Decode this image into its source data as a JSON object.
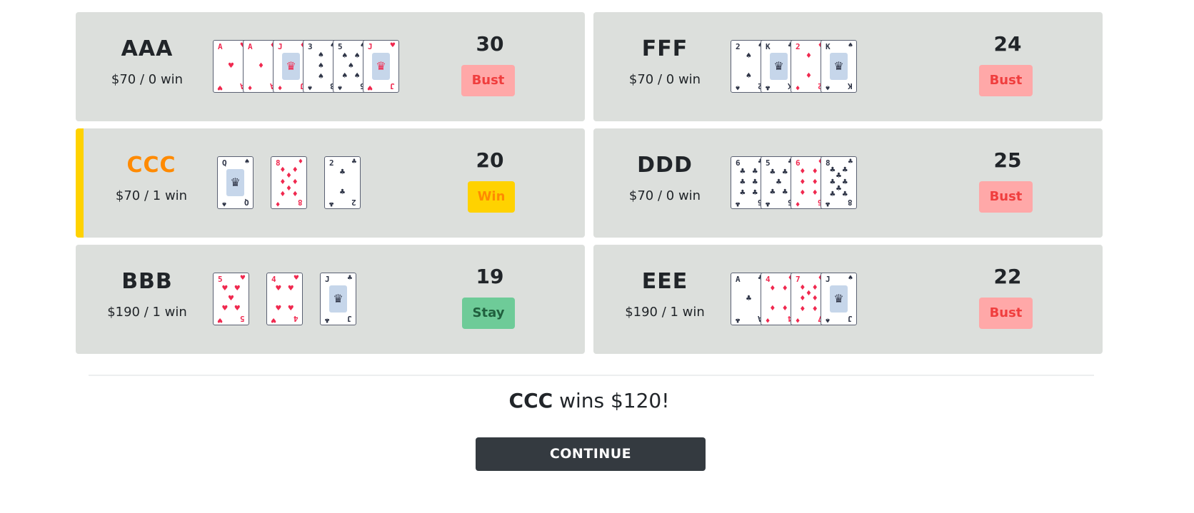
{
  "players": [
    {
      "name": "AAA",
      "money": "$70 / 0 win",
      "score": "30",
      "status": "Bust",
      "status_type": "bust",
      "active": false,
      "cards": [
        {
          "rank": "A",
          "suit": "♥",
          "color": "red"
        },
        {
          "rank": "A",
          "suit": "♦",
          "color": "red"
        },
        {
          "rank": "J",
          "suit": "♦",
          "color": "red"
        },
        {
          "rank": "3",
          "suit": "♠",
          "color": "black"
        },
        {
          "rank": "5",
          "suit": "♠",
          "color": "black"
        },
        {
          "rank": "J",
          "suit": "♥",
          "color": "red"
        }
      ]
    },
    {
      "name": "FFF",
      "money": "$70 / 0 win",
      "score": "24",
      "status": "Bust",
      "status_type": "bust",
      "active": false,
      "cards": [
        {
          "rank": "2",
          "suit": "♠",
          "color": "black"
        },
        {
          "rank": "K",
          "suit": "♣",
          "color": "black"
        },
        {
          "rank": "2",
          "suit": "♦",
          "color": "red"
        },
        {
          "rank": "K",
          "suit": "♠",
          "color": "black"
        }
      ]
    },
    {
      "name": "CCC",
      "money": "$70 / 1 win",
      "score": "20",
      "status": "Win",
      "status_type": "win",
      "active": true,
      "cards": [
        {
          "rank": "Q",
          "suit": "♠",
          "color": "black"
        },
        {
          "rank": "8",
          "suit": "♦",
          "color": "red"
        },
        {
          "rank": "2",
          "suit": "♣",
          "color": "black"
        }
      ]
    },
    {
      "name": "DDD",
      "money": "$70 / 0 win",
      "score": "25",
      "status": "Bust",
      "status_type": "bust",
      "active": false,
      "cards": [
        {
          "rank": "6",
          "suit": "♣",
          "color": "black"
        },
        {
          "rank": "5",
          "suit": "♣",
          "color": "black"
        },
        {
          "rank": "6",
          "suit": "♦",
          "color": "red"
        },
        {
          "rank": "8",
          "suit": "♣",
          "color": "black"
        }
      ]
    },
    {
      "name": "BBB",
      "money": "$190 / 1 win",
      "score": "19",
      "status": "Stay",
      "status_type": "stay",
      "active": false,
      "cards": [
        {
          "rank": "5",
          "suit": "♥",
          "color": "red"
        },
        {
          "rank": "4",
          "suit": "♥",
          "color": "red"
        },
        {
          "rank": "J",
          "suit": "♣",
          "color": "black"
        }
      ]
    },
    {
      "name": "EEE",
      "money": "$190 / 1 win",
      "score": "22",
      "status": "Bust",
      "status_type": "bust",
      "active": false,
      "cards": [
        {
          "rank": "A",
          "suit": "♣",
          "color": "black"
        },
        {
          "rank": "4",
          "suit": "♦",
          "color": "red"
        },
        {
          "rank": "7",
          "suit": "♦",
          "color": "red"
        },
        {
          "rank": "J",
          "suit": "♠",
          "color": "black"
        }
      ]
    }
  ],
  "result": {
    "winner": "CCC",
    "text": " wins $120!"
  },
  "continue_label": "CONTINUE",
  "colors": {
    "panel": "#dcdfdc",
    "active_bar": "#ffd200",
    "highlight_name": "#ff8a00",
    "bust_bg": "#ffa8a8",
    "bust_text": "#f03e3e",
    "win_bg": "#ffd200",
    "stay_bg": "#6ecb98",
    "card_red": "#f0294f",
    "card_black": "#2f3547",
    "button_bg": "#343a40"
  }
}
